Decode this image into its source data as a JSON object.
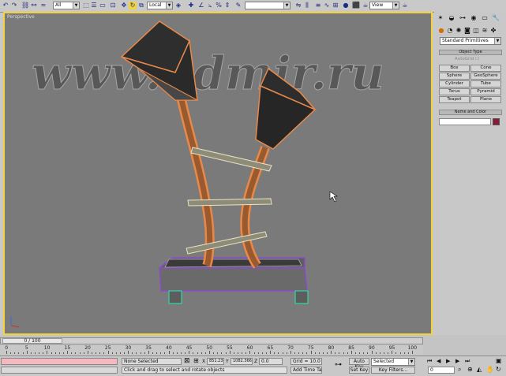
{
  "toolbar": {
    "undo_icon": "undo-icon",
    "redo_icon": "redo-icon",
    "selection_filter": "All",
    "reference_coord": "Local",
    "view_menu": "View"
  },
  "viewport": {
    "label": "Perspective",
    "watermark": "www.3dmir.ru"
  },
  "command_panel": {
    "category_dropdown": "Standard Primitives",
    "object_type_header": "Object Type",
    "autogrid_label": "AutoGrid",
    "buttons": [
      "Box",
      "Cone",
      "Sphere",
      "GeoSphere",
      "Cylinder",
      "Tube",
      "Torus",
      "Pyramid",
      "Teapot",
      "Plane"
    ],
    "name_color_header": "Name and Color",
    "name_value": "",
    "object_color": "#8a1a3a"
  },
  "timeline": {
    "frame_counter": "0 / 100",
    "ticks": [
      "0",
      "5",
      "10",
      "15",
      "20",
      "25",
      "30",
      "35",
      "40",
      "45",
      "50",
      "55",
      "60",
      "65",
      "70",
      "75",
      "80",
      "85",
      "90",
      "95",
      "100"
    ]
  },
  "status": {
    "selection": "None Selected",
    "prompt": "Click and drag to select and rotate objects",
    "x_label": "X",
    "x_value": "851.234",
    "y_label": "Y",
    "y_value": "1082.366",
    "z_label": "Z",
    "z_value": "0.0",
    "grid": "Grid = 10.0",
    "add_time_tag": "Add Time Tag",
    "auto_key": "Auto Key",
    "set_key": "Set Key",
    "selected": "Selected",
    "key_filters": "Key Filters...",
    "frame_value": "0"
  },
  "colors": {
    "viewport_bg": "#7a7a7a",
    "active_border": "#f4d23a",
    "selection": "#f0a060"
  }
}
